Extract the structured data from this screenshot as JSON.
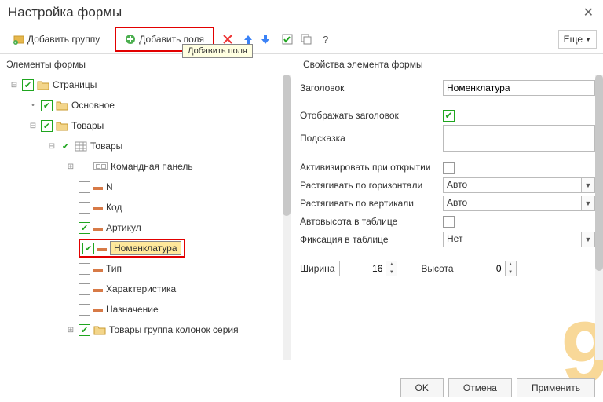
{
  "window": {
    "title": "Настройка формы"
  },
  "toolbar": {
    "add_group": "Добавить группу",
    "add_fields": "Добавить поля",
    "tooltip_add_fields": "Добавить поля",
    "more": "Еще",
    "help": "?"
  },
  "panes": {
    "left_title": "Элементы формы",
    "right_title": "Свойства элемента формы"
  },
  "tree": [
    {
      "level": 0,
      "exp": "minus",
      "chk": true,
      "icon": "folder",
      "label": "Страницы"
    },
    {
      "level": 1,
      "exp": "dot",
      "chk": true,
      "icon": "folder",
      "label": "Основное"
    },
    {
      "level": 1,
      "exp": "minus",
      "chk": true,
      "icon": "folder",
      "label": "Товары"
    },
    {
      "level": 2,
      "exp": "minus",
      "chk": true,
      "icon": "table",
      "label": "Товары"
    },
    {
      "level": 3,
      "exp": "plus",
      "chk": null,
      "icon": "cmdpanel",
      "label": "Командная панель"
    },
    {
      "level": 3,
      "exp": "none",
      "chk": false,
      "icon": "minus",
      "label": "N"
    },
    {
      "level": 3,
      "exp": "none",
      "chk": false,
      "icon": "minus",
      "label": "Код"
    },
    {
      "level": 3,
      "exp": "none",
      "chk": true,
      "icon": "minus",
      "label": "Артикул"
    },
    {
      "level": 3,
      "exp": "none",
      "chk": true,
      "icon": "minus",
      "label": "Номенклатура",
      "selected": true,
      "redbox": true
    },
    {
      "level": 3,
      "exp": "none",
      "chk": false,
      "icon": "minus",
      "label": "Тип"
    },
    {
      "level": 3,
      "exp": "none",
      "chk": false,
      "icon": "minus",
      "label": "Характеристика"
    },
    {
      "level": 3,
      "exp": "none",
      "chk": false,
      "icon": "minus",
      "label": "Назначение"
    },
    {
      "level": 3,
      "exp": "plus",
      "chk": true,
      "icon": "folder",
      "label": "Товары группа колонок серия"
    }
  ],
  "props": {
    "title_label": "Заголовок",
    "title_value": "Номенклатура",
    "show_title_label": "Отображать заголовок",
    "show_title_value": true,
    "hint_label": "Подсказка",
    "hint_value": "",
    "activate_label": "Активизировать при открытии",
    "activate_value": false,
    "stretch_h_label": "Растягивать по горизонтали",
    "stretch_h_value": "Авто",
    "stretch_v_label": "Растягивать по вертикали",
    "stretch_v_value": "Авто",
    "autoheight_label": "Автовысота в таблице",
    "autoheight_value": false,
    "fix_label": "Фиксация в таблице",
    "fix_value": "Нет",
    "width_label": "Ширина",
    "width_value": "16",
    "height_label": "Высота",
    "height_value": "0"
  },
  "footer": {
    "ok": "OK",
    "cancel": "Отмена",
    "apply": "Применить"
  }
}
